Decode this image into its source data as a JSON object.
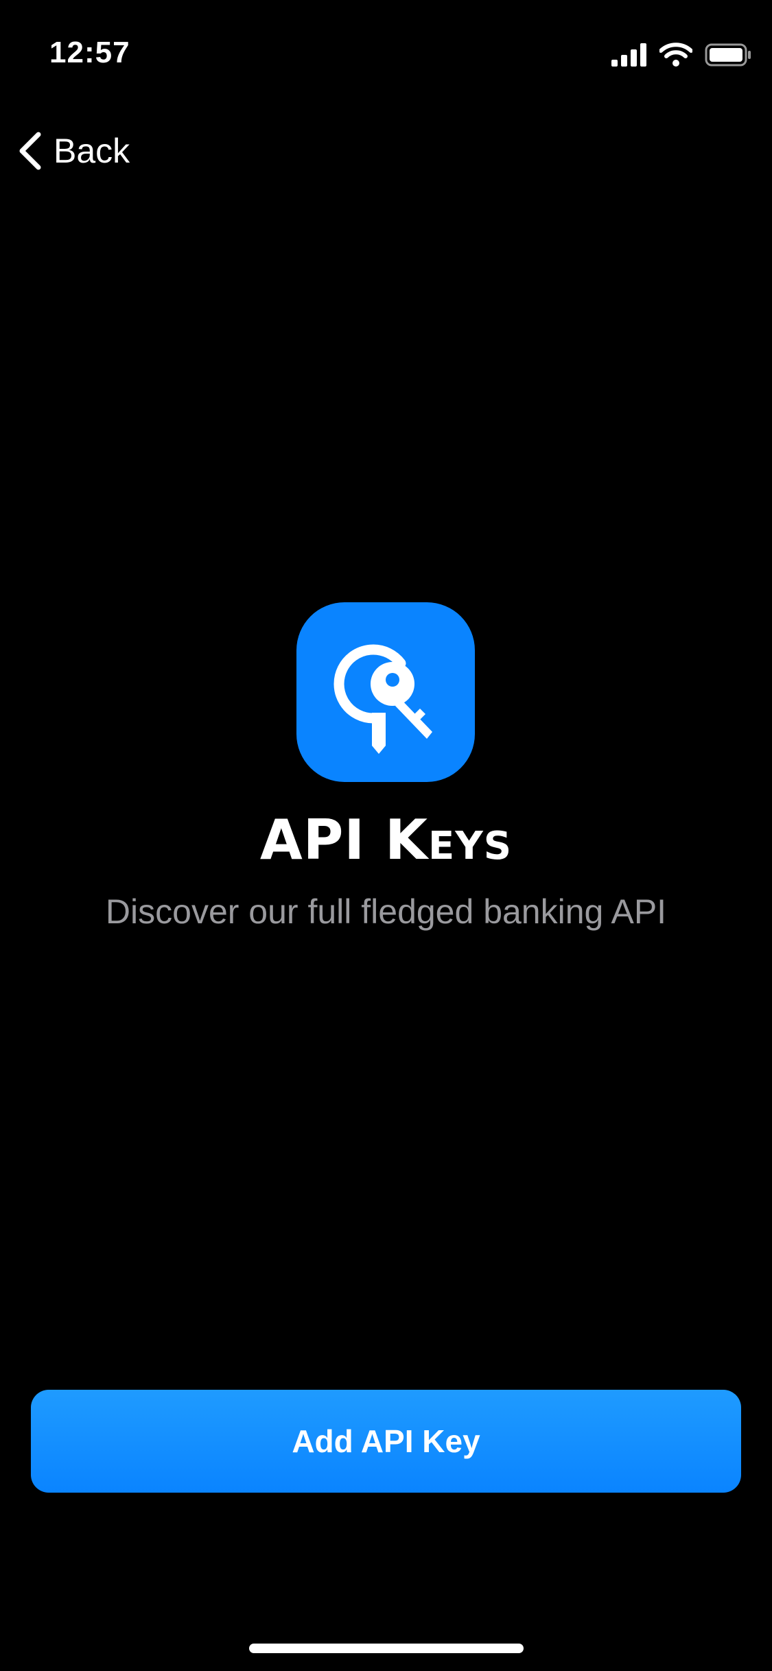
{
  "status_bar": {
    "time": "12:57",
    "icons": [
      "signal-icon",
      "wifi-icon",
      "battery-icon"
    ]
  },
  "nav": {
    "back_label": "Back",
    "back_icon": "chevron-left-icon"
  },
  "hero": {
    "icon": "keys-icon",
    "title": "API Keys",
    "subtitle": "Discover our full fledged banking API"
  },
  "actions": {
    "primary_label": "Add API Key"
  },
  "colors": {
    "accent": "#0a84ff",
    "background": "#000000",
    "subtitle": "#9a9a9e"
  }
}
